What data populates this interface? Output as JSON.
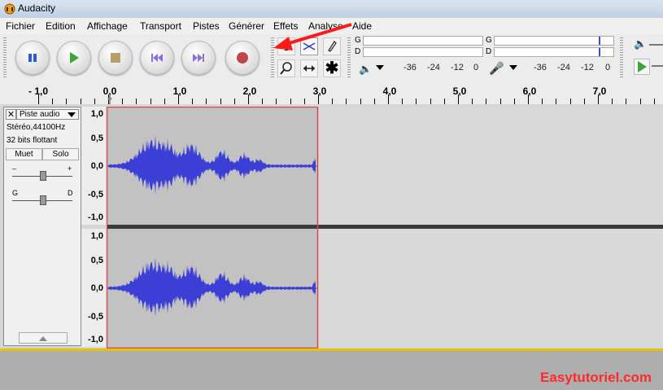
{
  "window": {
    "title": "Audacity"
  },
  "menu": [
    "Fichier",
    "Edition",
    "Affichage",
    "Transport",
    "Pistes",
    "Générer",
    "Effets",
    "Analyse",
    "Aide"
  ],
  "transport": {
    "buttons": [
      "pause-icon",
      "play-icon",
      "stop-icon",
      "skip-start-icon",
      "skip-end-icon",
      "record-icon"
    ]
  },
  "tools": [
    "selection-icon",
    "envelope-icon",
    "draw-icon",
    "zoom-icon",
    "timeshift-icon",
    "multi-tool-icon"
  ],
  "meters": {
    "play": {
      "left_label": "G",
      "right_label": "D",
      "ticks": [
        "-36",
        "-24",
        "-12",
        "0"
      ]
    },
    "record": {
      "left_label": "G",
      "right_label": "D",
      "ticks": [
        "-36",
        "-24",
        "-12",
        "0"
      ]
    }
  },
  "ruler": {
    "labels": [
      "- 1,0",
      "0,0",
      "1,0",
      "2,0",
      "3,0",
      "4,0",
      "5,0",
      "6,0",
      "7,0"
    ]
  },
  "track": {
    "name": "Piste audio",
    "format": "Stéréo,44100Hz",
    "depth": "32 bits flottant",
    "mute_label": "Muet",
    "solo_label": "Solo",
    "gain_minus": "–",
    "gain_plus": "+",
    "pan_left": "G",
    "pan_right": "D"
  },
  "vruler": {
    "labels": [
      "1,0",
      "0,5",
      "0,0",
      "-0,5",
      "-1,0"
    ]
  },
  "colors": {
    "waveform": "#3b3fd6",
    "selection_bg": "#c2c2c2",
    "selection_border": "#d84a4a",
    "arrow": "#ff1a1a"
  },
  "watermark": "Easytutoriel.com"
}
